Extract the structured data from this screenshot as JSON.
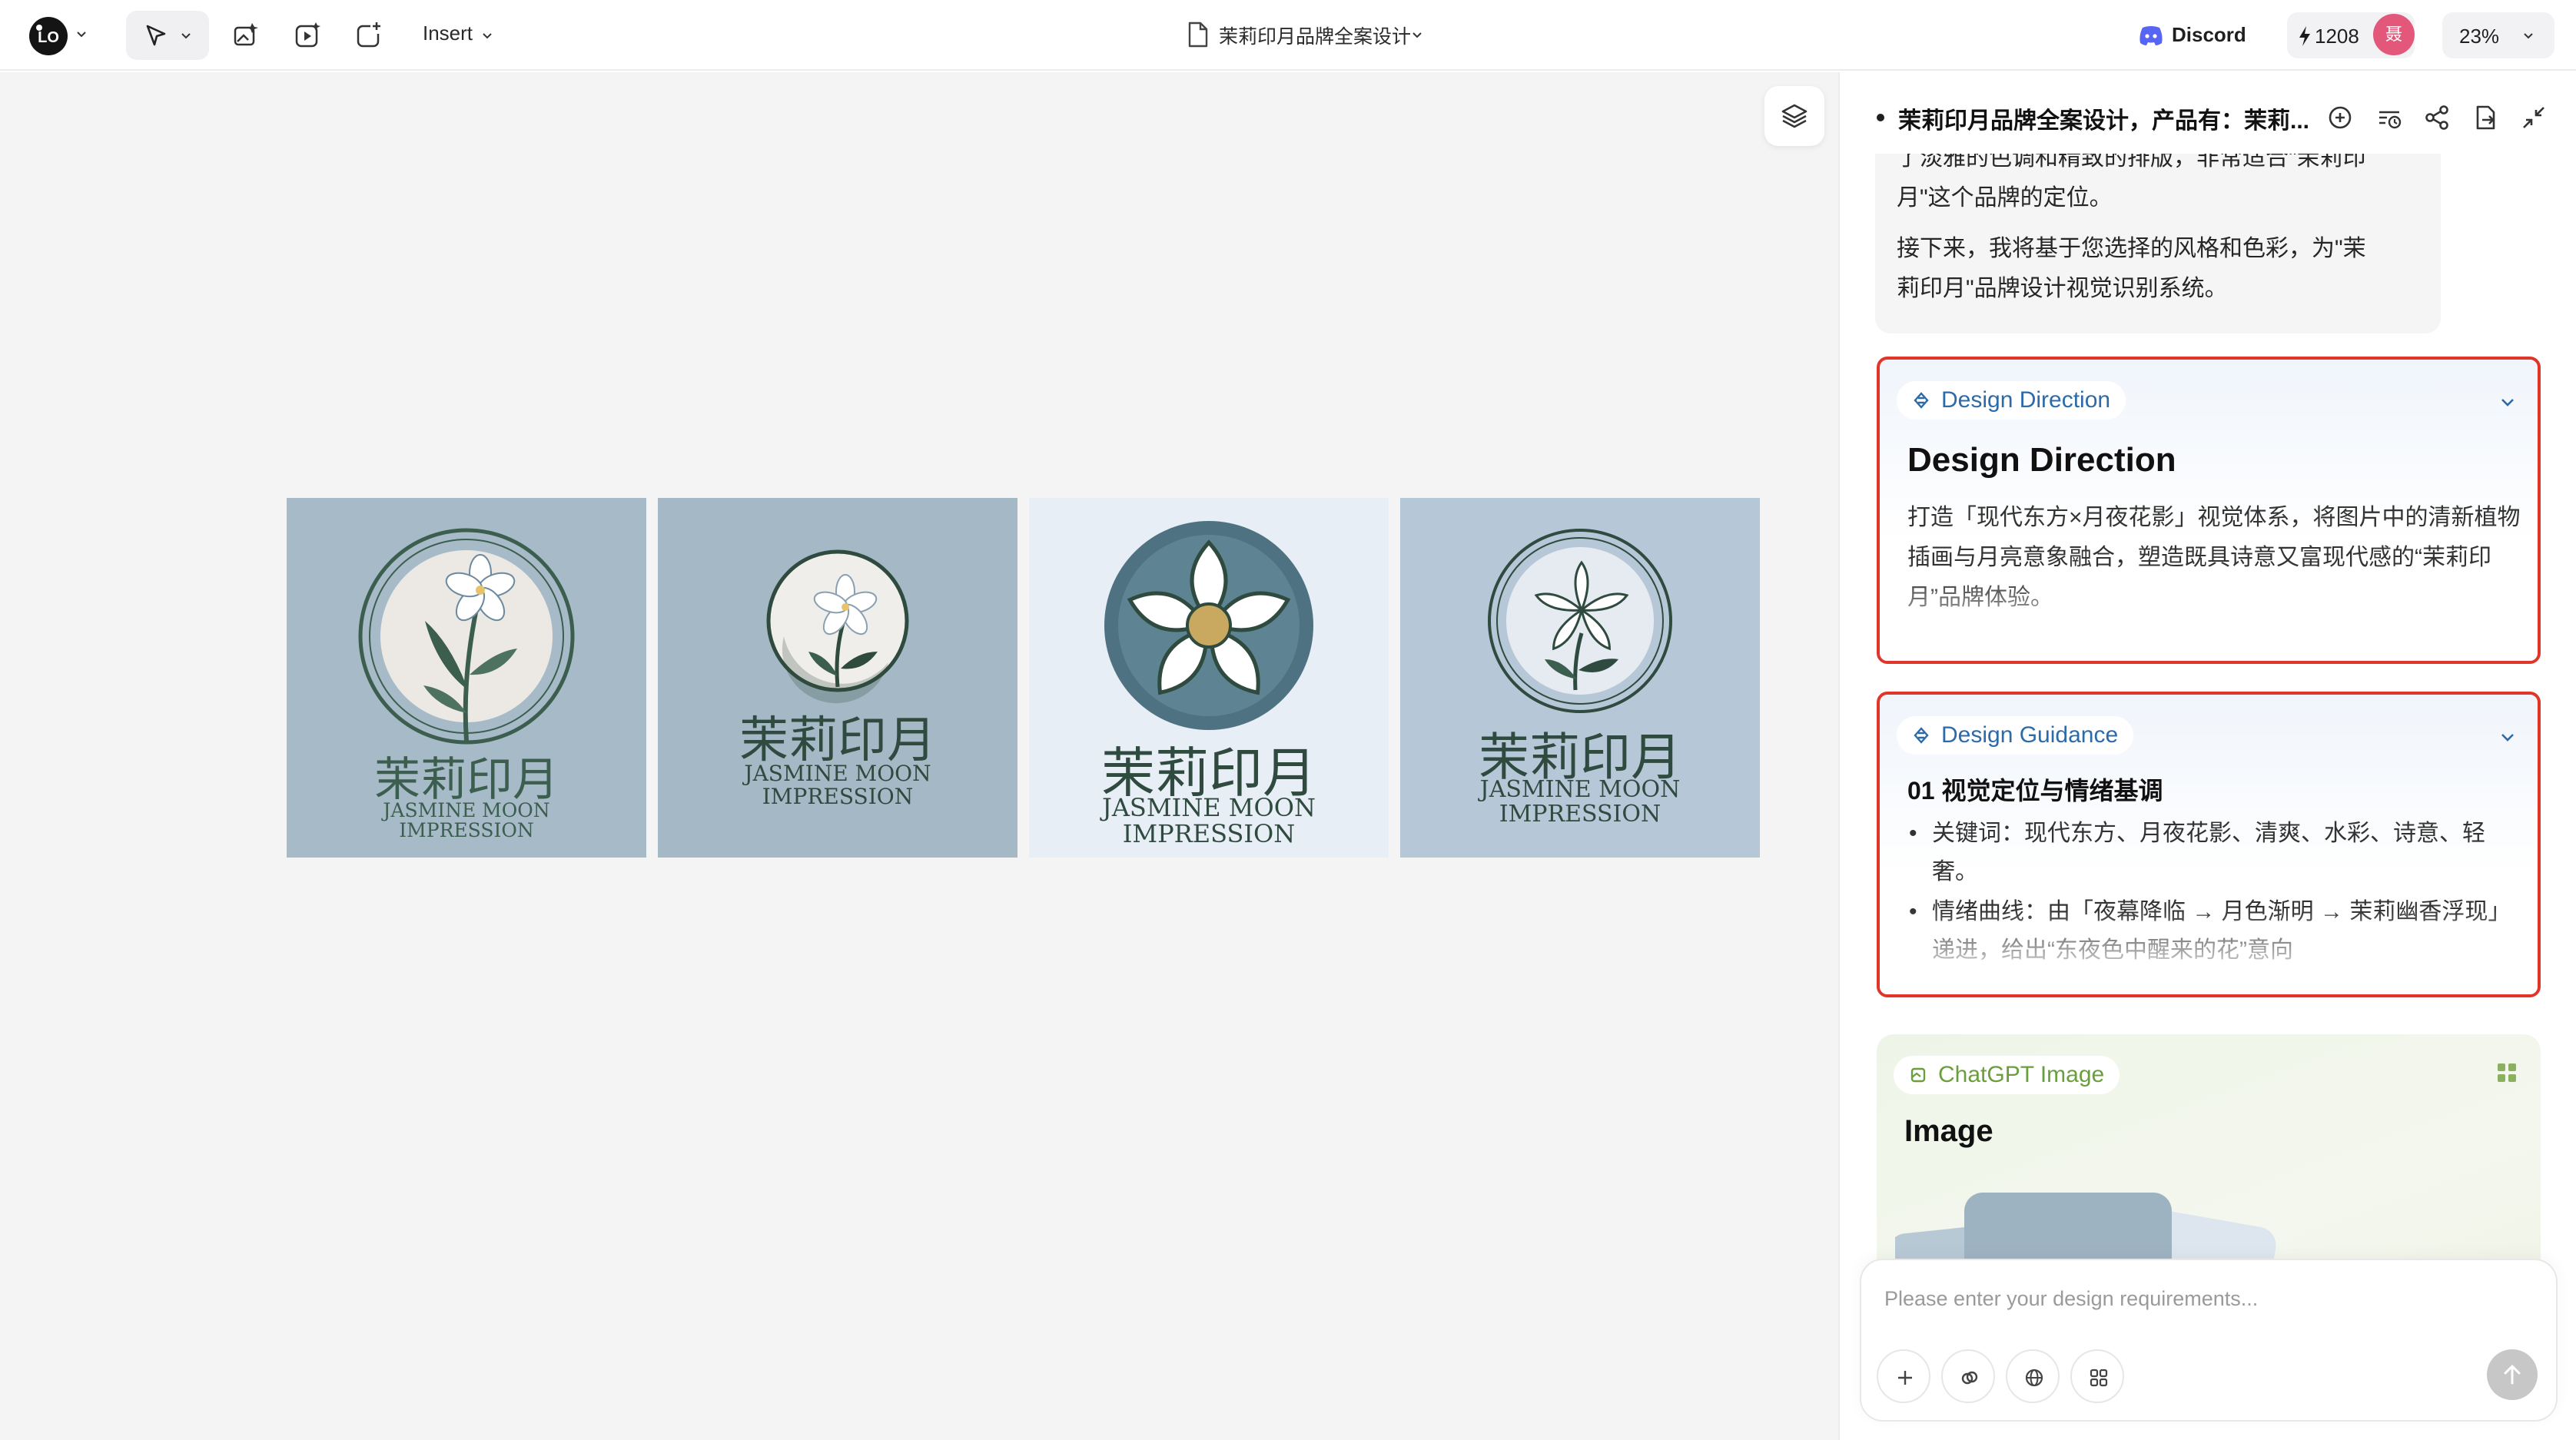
{
  "topbar": {
    "insert_label": "Insert",
    "doc_title": "茉莉印月品牌全案设计",
    "discord_label": "Discord",
    "credits": "1208",
    "avatar_initial": "聂",
    "zoom": "23%"
  },
  "canvas": {
    "logos": [
      {
        "cn": "茉莉印月",
        "en1": "JASMINE MOON",
        "en2": "IMPRESSION",
        "bg": "#a6bac8"
      },
      {
        "cn": "茉莉印月",
        "en1": "JASMINE MOON",
        "en2": "IMPRESSION",
        "bg": "#a4b8c6"
      },
      {
        "cn": "茉莉印月",
        "en1": "JASMINE MOON",
        "en2": "IMPRESSION",
        "bg": "#e8eef6"
      },
      {
        "cn": "茉莉印月",
        "en1": "JASMINE MOON",
        "en2": "IMPRESSION",
        "bg": "#b6c8d8"
      }
    ]
  },
  "panel": {
    "title": "茉莉印月品牌全案设计，产品有：茉莉...",
    "message_lines": [
      "了淡雅的色调和精致的排版，非常适合\"茉莉印",
      "月\"这个品牌的定位。",
      "接下来，我将基于您选择的风格和色彩，为\"茉",
      "莉印月\"品牌设计视觉识别系统。"
    ],
    "direction_card": {
      "tag": "Design Direction",
      "heading": "Design Direction",
      "body": "打造「现代东方×月夜花影」视觉体系，将图片中的清新植物插画与月亮意象融合，塑造既具诗意又富现代感的“茉莉印月”品牌体验。"
    },
    "guidance_card": {
      "tag": "Design Guidance",
      "heading": "01 视觉定位与情绪基调",
      "bullets": [
        "关键词：现代东方、月夜花影、清爽、水彩、诗意、轻奢。",
        "情绪曲线：由「夜幕降临 → 月色渐明 → 茉莉幽香浮现」递进，给出“东夜色中醒来的花”意向"
      ]
    },
    "image_card": {
      "tag": "ChatGPT Image",
      "heading": "Image"
    },
    "composer": {
      "placeholder": "Please enter your design requirements..."
    }
  },
  "colors": {
    "accent_red": "#e0362a",
    "tag_blue": "#2c6aa8",
    "tag_green": "#6b9e3c",
    "logo_green": "#3c5e4e"
  }
}
